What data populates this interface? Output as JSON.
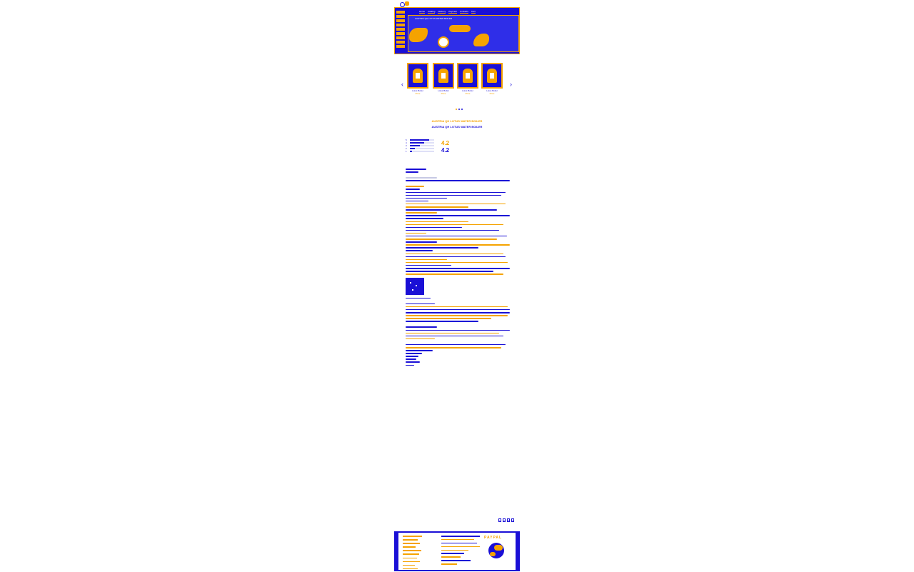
{
  "header": {
    "nav": [
      "Home",
      "Catalog",
      "Delivery",
      "Payment",
      "Contacts",
      "Cart"
    ],
    "hero_text": "AUSTRIA QH LOTUS WATER BOILER"
  },
  "products": {
    "prev_label": "‹",
    "next_label": "›",
    "items": [
      {
        "name": "Lotus Boiler",
        "price": "Price"
      },
      {
        "name": "Lotus Boiler",
        "price": "Price"
      },
      {
        "name": "Lotus Boiler",
        "price": "Price"
      },
      {
        "name": "Lotus Boiler",
        "price": "Price"
      }
    ]
  },
  "titles": {
    "primary": "AUSTRIA QH LOTUS WATER BOILER",
    "secondary": "AUSTRIA QH LOTUS WATER BOILER"
  },
  "rating": {
    "score_a": "4.2",
    "score_b": "4.2",
    "bars": [
      {
        "label": "5",
        "level": 0.8
      },
      {
        "label": "4",
        "level": 0.6
      },
      {
        "label": "3",
        "level": 0.4
      },
      {
        "label": "2",
        "level": 0.2
      },
      {
        "label": "1",
        "level": 0.1
      }
    ]
  },
  "pager": [
    "1",
    "2",
    "3",
    "4"
  ],
  "footer": {
    "payment": "PAYPAL"
  },
  "colors": {
    "primary": "#1a0fd6",
    "accent": "#f5a300"
  }
}
